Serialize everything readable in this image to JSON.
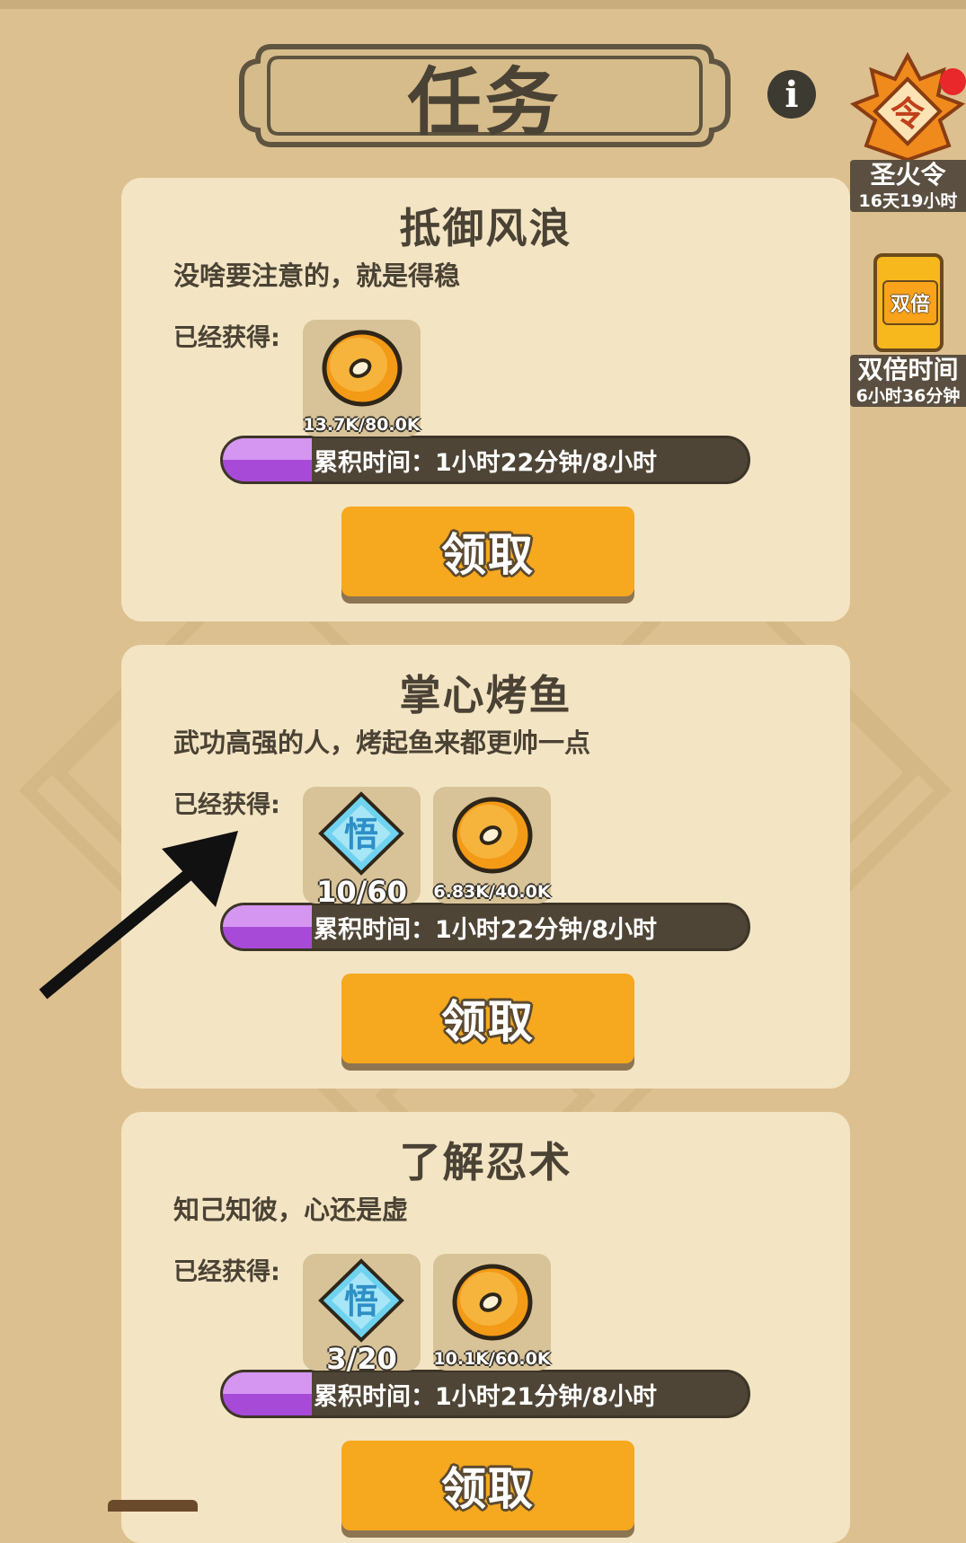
{
  "header": {
    "title": "任务",
    "info_icon_glyph": "i"
  },
  "side": {
    "token": {
      "label": "圣火令",
      "time": "16天19小时",
      "icon_glyph": "令",
      "has_notification": true
    },
    "double": {
      "label": "双倍时间",
      "time": "6小时36分钟",
      "icon_glyph": "双倍"
    }
  },
  "earned_label": "已经获得:",
  "claim_label": "领取",
  "tasks": [
    {
      "title": "抵御风浪",
      "desc": "没啥要注意的，就是得稳",
      "rewards": [
        {
          "icon": "coin-icon",
          "count": "13.7K/80.0K"
        }
      ],
      "progress_text": "累积时间：1小时22分钟/8小时",
      "progress": 0.17
    },
    {
      "title": "掌心烤鱼",
      "desc": "武功高强的人，烤起鱼来都更帅一点",
      "rewards": [
        {
          "icon": "wu-gem-icon",
          "glyph": "悟",
          "count": "10/60"
        },
        {
          "icon": "coin-icon",
          "count": "6.83K/40.0K"
        }
      ],
      "progress_text": "累积时间：1小时22分钟/8小时",
      "progress": 0.17
    },
    {
      "title": "了解忍术",
      "desc": "知己知彼，心还是虚",
      "rewards": [
        {
          "icon": "wu-gem-icon",
          "glyph": "悟",
          "count": "3/20"
        },
        {
          "icon": "coin-icon",
          "count": "10.1K/60.0K"
        }
      ],
      "progress_text": "累积时间：1小时21分钟/8小时",
      "progress": 0.17
    }
  ],
  "colors": {
    "background": "#dcc090",
    "card": "#f3e4c3",
    "button": "#f6a81e",
    "progress_fill": "#a84ad8",
    "progress_track": "#4f4536"
  }
}
